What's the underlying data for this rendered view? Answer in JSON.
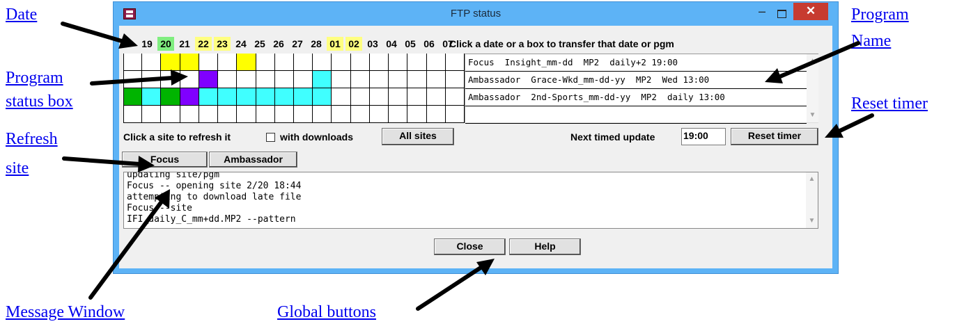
{
  "window": {
    "title": "FTP status",
    "minimize_glyph": "–",
    "close_glyph": "✕",
    "colors": {
      "frame": "#5db3f6",
      "close": "#c73b30"
    }
  },
  "dates": [
    {
      "label": "19",
      "hl": ""
    },
    {
      "label": "20",
      "hl": "#80ee80"
    },
    {
      "label": "21",
      "hl": ""
    },
    {
      "label": "22",
      "hl": "#ffff80"
    },
    {
      "label": "23",
      "hl": "#ffff80"
    },
    {
      "label": "24",
      "hl": ""
    },
    {
      "label": "25",
      "hl": ""
    },
    {
      "label": "26",
      "hl": ""
    },
    {
      "label": "27",
      "hl": ""
    },
    {
      "label": "28",
      "hl": ""
    },
    {
      "label": "01",
      "hl": "#ffff80"
    },
    {
      "label": "02",
      "hl": "#ffff80"
    },
    {
      "label": "03",
      "hl": ""
    },
    {
      "label": "04",
      "hl": ""
    },
    {
      "label": "05",
      "hl": ""
    },
    {
      "label": "06",
      "hl": ""
    },
    {
      "label": "07",
      "hl": ""
    }
  ],
  "instruction": "Click a date or a box to transfer that date or pgm",
  "status_colors": {
    "Y": "#ffff00",
    "C": "#40ffff",
    "G": "#00b400",
    "P": "#8000ff",
    "W": "#ffffff"
  },
  "status_rows": [
    [
      "W",
      "W",
      "Y",
      "Y",
      "W",
      "W",
      "Y",
      "W",
      "W",
      "W",
      "W",
      "W",
      "W",
      "W",
      "W",
      "W",
      "W",
      "W"
    ],
    [
      "W",
      "W",
      "W",
      "W",
      "P",
      "W",
      "W",
      "W",
      "W",
      "W",
      "C",
      "W",
      "W",
      "W",
      "W",
      "W",
      "W",
      "W"
    ],
    [
      "G",
      "C",
      "G",
      "P",
      "C",
      "C",
      "C",
      "C",
      "C",
      "C",
      "C",
      "W",
      "W",
      "W",
      "W",
      "W",
      "W",
      "W"
    ],
    [
      "W",
      "W",
      "W",
      "W",
      "W",
      "W",
      "W",
      "W",
      "W",
      "W",
      "W",
      "W",
      "W",
      "W",
      "W",
      "W",
      "W",
      "W"
    ]
  ],
  "programs": [
    "Focus  Insight_mm-dd  MP2  daily+2 19:00",
    "Ambassador  Grace-Wkd_mm-dd-yy  MP2  Wed 13:00",
    "Ambassador  2nd-Sports_mm-dd-yy  MP2  daily 13:00",
    ""
  ],
  "refresh": {
    "label": "Click a site to refresh it",
    "with_downloads_label": "with downloads",
    "with_downloads_checked": false,
    "all_sites_button": "All sites"
  },
  "timer": {
    "label": "Next timed update",
    "value": "19:00",
    "reset_button": "Reset timer"
  },
  "sites": [
    "Focus",
    "Ambassador"
  ],
  "messages": [
    "updating site/pgm",
    "Focus -- opening site 2/20 18:44",
    "attempting to download late file",
    "Focus --site",
    "IFI_daily_C_mm+dd.MP2 --pattern"
  ],
  "global_buttons": {
    "close": "Close",
    "help": "Help"
  },
  "annotations": {
    "date": "Date",
    "program_status_box_1": "Program",
    "program_status_box_2": "status box",
    "refresh_site_1": "Refresh",
    "refresh_site_2": "site",
    "message_window": "Message Window",
    "global_buttons": "Global buttons",
    "program_name_1": "Program",
    "program_name_2": "Name",
    "reset_timer": "Reset timer"
  }
}
